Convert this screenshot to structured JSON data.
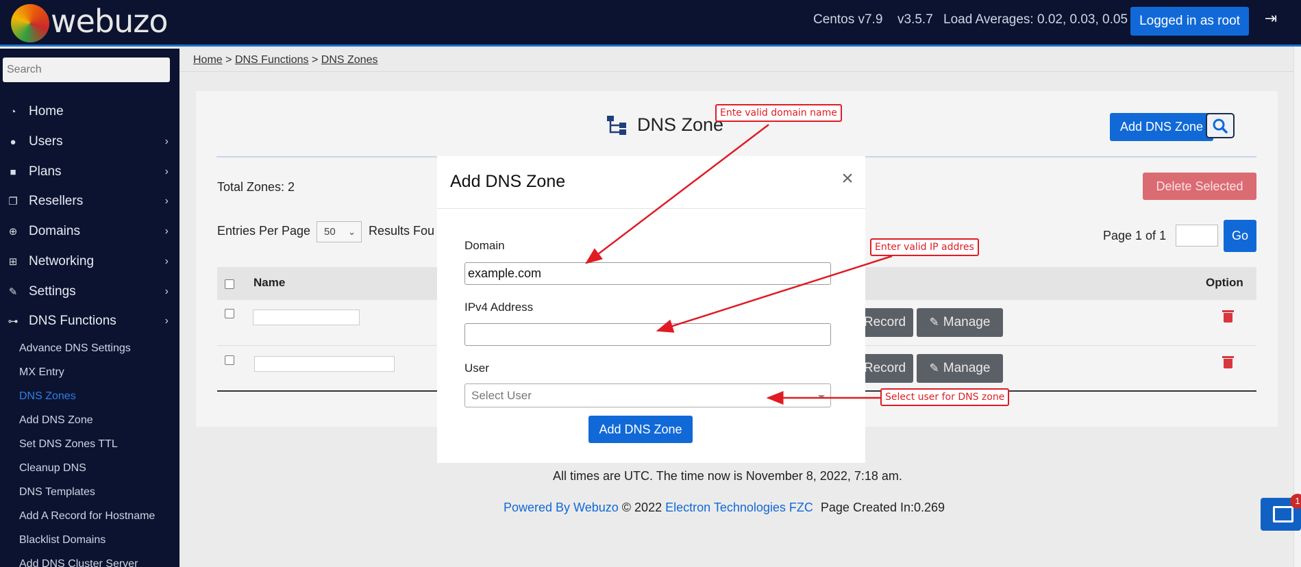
{
  "header": {
    "logo_text": "webuzo",
    "os": "Centos v7.9",
    "version": "v3.5.7",
    "load_averages": "Load Averages: 0.02, 0.03, 0.05",
    "login_label": "Logged in as root"
  },
  "sidebar": {
    "search_placeholder": "Search",
    "items": [
      {
        "label": "Home",
        "icon": "dashboard-icon"
      },
      {
        "label": "Users",
        "icon": "user-icon"
      },
      {
        "label": "Plans",
        "icon": "book-icon"
      },
      {
        "label": "Resellers",
        "icon": "copy-icon"
      },
      {
        "label": "Domains",
        "icon": "globe-icon"
      },
      {
        "label": "Networking",
        "icon": "network-icon"
      },
      {
        "label": "Settings",
        "icon": "wrench-icon"
      },
      {
        "label": "DNS Functions",
        "icon": "sitemap-icon"
      }
    ],
    "dns_subitems": [
      "Advance DNS Settings",
      "MX Entry",
      "DNS Zones",
      "Add DNS Zone",
      "Set DNS Zones TTL",
      "Cleanup DNS",
      "DNS Templates",
      "Add A Record for Hostname",
      "Blacklist Domains",
      "Add DNS Cluster Server"
    ],
    "active_subitem": "DNS Zones"
  },
  "breadcrumb": {
    "home": "Home",
    "sep": ">",
    "dns_functions": "DNS Functions",
    "dns_zones": "DNS Zones"
  },
  "page": {
    "title": "DNS Zone",
    "add_button": "Add DNS Zone",
    "total_zones": "Total Zones: 2",
    "delete_selected": "Delete Selected",
    "entries_label": "Entries Per Page",
    "entries_value": "50",
    "results_label": "Results Fou",
    "page_of": "Page 1 of 1",
    "go_button": "Go",
    "columns": {
      "name": "Name",
      "option": "Option"
    },
    "row_buttons": {
      "record": "Record",
      "manage": "Manage"
    }
  },
  "modal": {
    "title": "Add DNS Zone",
    "domain_label": "Domain",
    "domain_value": "example.com",
    "ipv4_label": "IPv4 Address",
    "ipv4_value": "",
    "user_label": "User",
    "user_placeholder": "Select User",
    "submit": "Add DNS Zone"
  },
  "annotations": {
    "domain": "Ente valid domain name",
    "ip": "Enter valid IP addres",
    "user": "Select user for DNS zone"
  },
  "footer": {
    "time": "All times are UTC. The time now is November 8, 2022, 7:18 am.",
    "powered_by": "Powered By Webuzo",
    "copyright": "© 2022",
    "company": "Electron Technologies FZC",
    "page_created": "Page Created In:0.269",
    "news_badge": "1"
  },
  "colors": {
    "sidebar_bg": "#0b1330",
    "primary": "#1169d7",
    "danger": "#d9363e",
    "annotation": "#e01b24"
  }
}
